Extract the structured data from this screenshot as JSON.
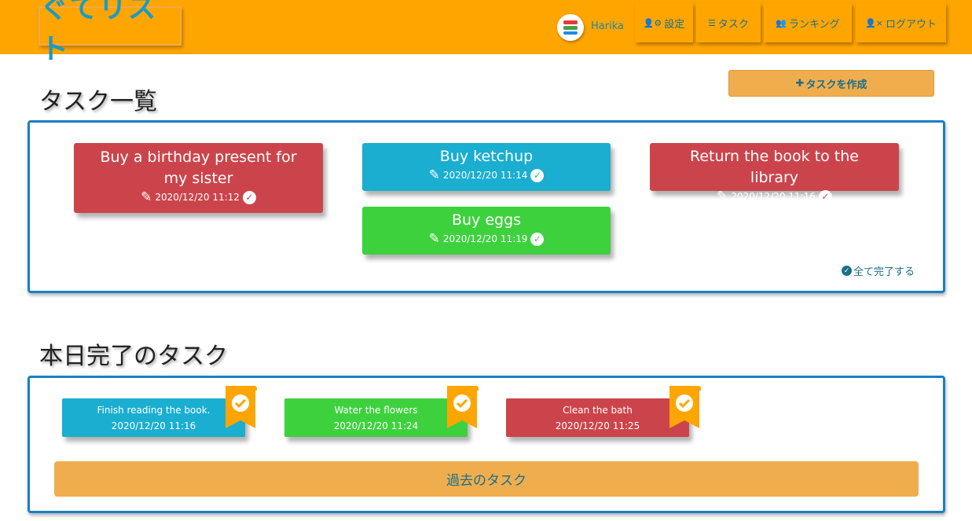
{
  "header": {
    "logo": "ぐてリスト",
    "username": "Harika",
    "nav": [
      {
        "icon": "user-cog-icon",
        "glyph": "👤⚙",
        "label": "設定"
      },
      {
        "icon": "list-icon",
        "glyph": "☰",
        "label": "タスク"
      },
      {
        "icon": "users-icon",
        "glyph": "👥",
        "label": "ランキング"
      },
      {
        "icon": "user-times-icon",
        "glyph": "👤×",
        "label": "ログアウト"
      }
    ]
  },
  "tasks_section": {
    "title": "タスク一覧",
    "create_button": "タスクを作成",
    "complete_all": "全て完了する",
    "tasks": [
      {
        "title": "Buy a birthday present for my sister",
        "datetime": "2020/12/20 11:12",
        "color": "#cc444b"
      },
      {
        "title": "Buy ketchup",
        "datetime": "2020/12/20 11:14",
        "color": "#1aaed0"
      },
      {
        "title": "Return the book to the library",
        "datetime": "2020/12/20 11:16",
        "color": "#cc444b"
      },
      {
        "title": "Buy eggs",
        "datetime": "2020/12/20 11:19",
        "color": "#3ed13e"
      }
    ]
  },
  "done_section": {
    "title": "本日完了のタスク",
    "past_button": "過去のタスク",
    "tasks": [
      {
        "title": "Finish reading the book.",
        "datetime": "2020/12/20 11:16",
        "color": "#1aaed0"
      },
      {
        "title": "Water the flowers",
        "datetime": "2020/12/20 11:24",
        "color": "#3ed13e"
      },
      {
        "title": "Clean the bath",
        "datetime": "2020/12/20 11:25",
        "color": "#cc444b"
      }
    ]
  },
  "colors": {
    "header": "#FFA500",
    "accent_text": "#1a6f8a",
    "button": "#f0ad4e",
    "panel_border": "#1a7fc4"
  }
}
